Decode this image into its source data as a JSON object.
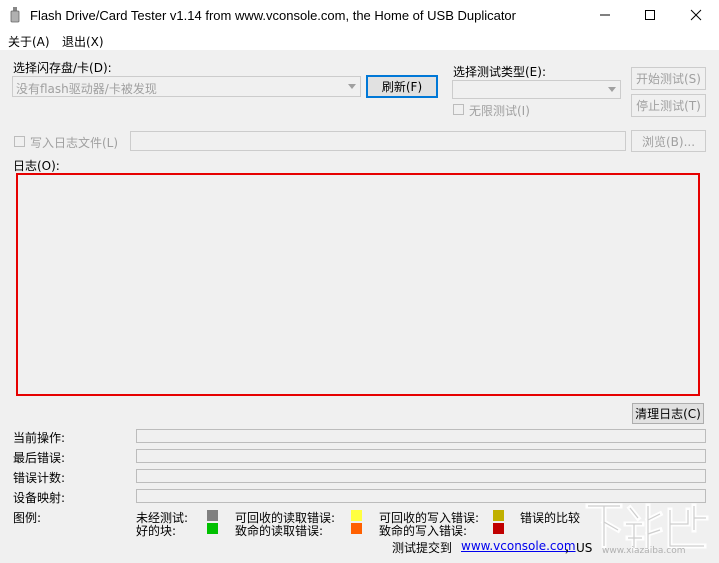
{
  "window": {
    "title": "Flash Drive/Card Tester v1.14 from www.vconsole.com, the Home of USB Duplicator"
  },
  "menu": {
    "about": "关于(A)",
    "exit": "退出(X)"
  },
  "drive": {
    "label": "选择闪存盘/卡(D):",
    "selected": "没有flash驱动器/卡被发现",
    "refresh_button": "刷新(F)"
  },
  "test_type": {
    "label": "选择测试类型(E):",
    "selected": "",
    "unlimited_label": "无限测试(I)",
    "unlimited_checked": false
  },
  "buttons": {
    "start": "开始测试(S)",
    "stop": "停止测试(T)",
    "browse": "浏览(B)...",
    "clear_log": "清理日志(C)"
  },
  "log_file": {
    "label": "写入日志文件(L)",
    "checked": false,
    "path": ""
  },
  "log": {
    "label": "日志(O):",
    "content": ""
  },
  "status": {
    "current_op_label": "当前操作:",
    "last_error_label": "最后错误:",
    "error_count_label": "错误计数:",
    "device_map_label": "设备映射:"
  },
  "legend": {
    "label": "图例:",
    "items": [
      {
        "text": "未经测试:",
        "color": "#808080"
      },
      {
        "text": "好的块:",
        "color": "#00c000"
      },
      {
        "text": "可回收的读取错误:",
        "color": "#ffff40"
      },
      {
        "text": "致命的读取错误:",
        "color": "#ff6000"
      },
      {
        "text": "可回收的写入错误:",
        "color": "#c0b000"
      },
      {
        "text": "致命的写入错误:",
        "color": "#c00000"
      },
      {
        "text": "错误的比较",
        "color": null
      }
    ]
  },
  "footer": {
    "prefix": "测试提交到",
    "link": "www.vconsole.com",
    "suffix": "，US"
  },
  "watermark": {
    "text": "下载吧",
    "url_text": "www.xiazaiba.com"
  },
  "colors": {
    "log_border": "#e60000",
    "link": "#0000ee"
  }
}
